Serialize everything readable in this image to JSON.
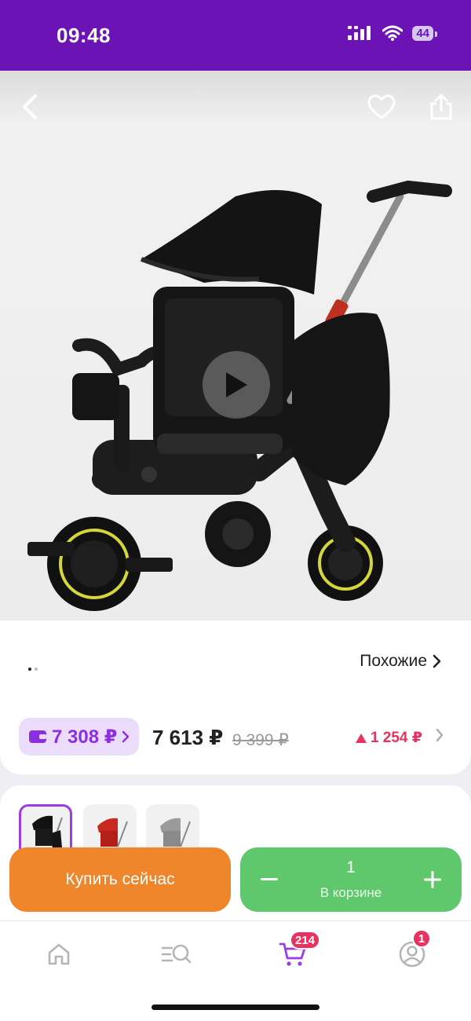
{
  "status_bar": {
    "time": "09:48",
    "battery": "44"
  },
  "product": {
    "similar_label": "Похожие",
    "wallet_price": "7 308 ₽",
    "price": "7 613 ₽",
    "old_price": "9 399 ₽",
    "discount": "1 254 ₽",
    "variants": [
      "black",
      "red",
      "grey"
    ]
  },
  "actions": {
    "buy_now": "Купить сейчас",
    "quantity": "1",
    "in_cart": "В корзине",
    "minus": "−",
    "plus": "+"
  },
  "tab_bar": {
    "cart_badge": "214",
    "profile_badge": "1"
  },
  "colors": {
    "brand": "#6b13b4",
    "buy": "#f0862c",
    "cart": "#5fc86d",
    "sale": "#e8325f"
  }
}
